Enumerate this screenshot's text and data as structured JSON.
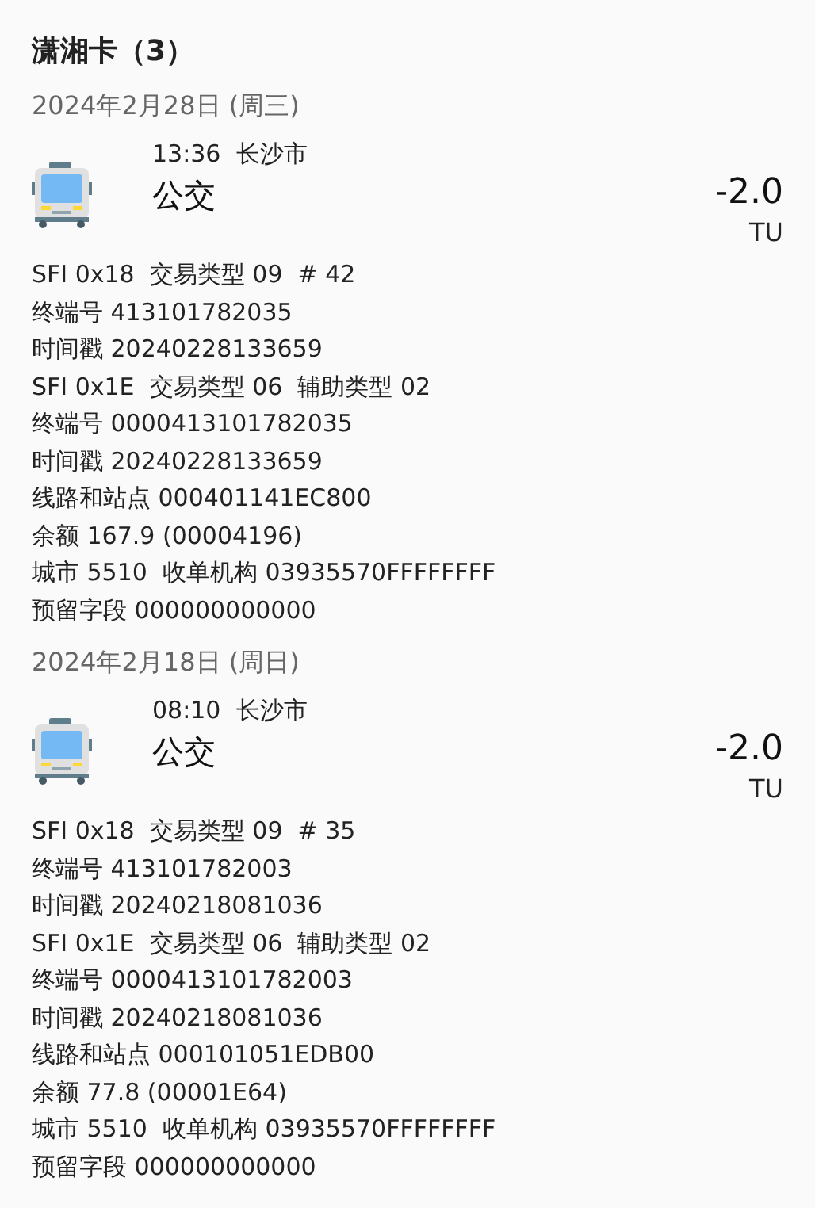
{
  "title": "潇湘卡（3）",
  "groups": [
    {
      "date": "2024年2月28日 (周三)",
      "transactions": [
        {
          "kind": "bus",
          "time": "13:36",
          "city": "长沙市",
          "name": "公交",
          "amount": "-2.0",
          "unit": "TU",
          "details": [
            "SFI 0x18  交易类型 09  # 42",
            "终端号 413101782035",
            "时间戳 20240228133659",
            "SFI 0x1E  交易类型 06  辅助类型 02",
            "终端号 0000413101782035",
            "时间戳 20240228133659",
            "线路和站点 000401141EC800",
            "余额 167.9 (00004196)",
            "城市 5510  收单机构 03935570FFFFFFFF",
            "预留字段 000000000000"
          ]
        }
      ]
    },
    {
      "date": "2024年2月18日 (周日)",
      "transactions": [
        {
          "kind": "bus",
          "time": "08:10",
          "city": "长沙市",
          "name": "公交",
          "amount": "-2.0",
          "unit": "TU",
          "details": [
            "SFI 0x18  交易类型 09  # 35",
            "终端号 413101782003",
            "时间戳 20240218081036",
            "SFI 0x1E  交易类型 06  辅助类型 02",
            "终端号 0000413101782003",
            "时间戳 20240218081036",
            "线路和站点 000101051EDB00",
            "余额 77.8 (00001E64)",
            "城市 5510  收单机构 03935570FFFFFFFF",
            "预留字段 000000000000"
          ]
        }
      ]
    }
  ]
}
